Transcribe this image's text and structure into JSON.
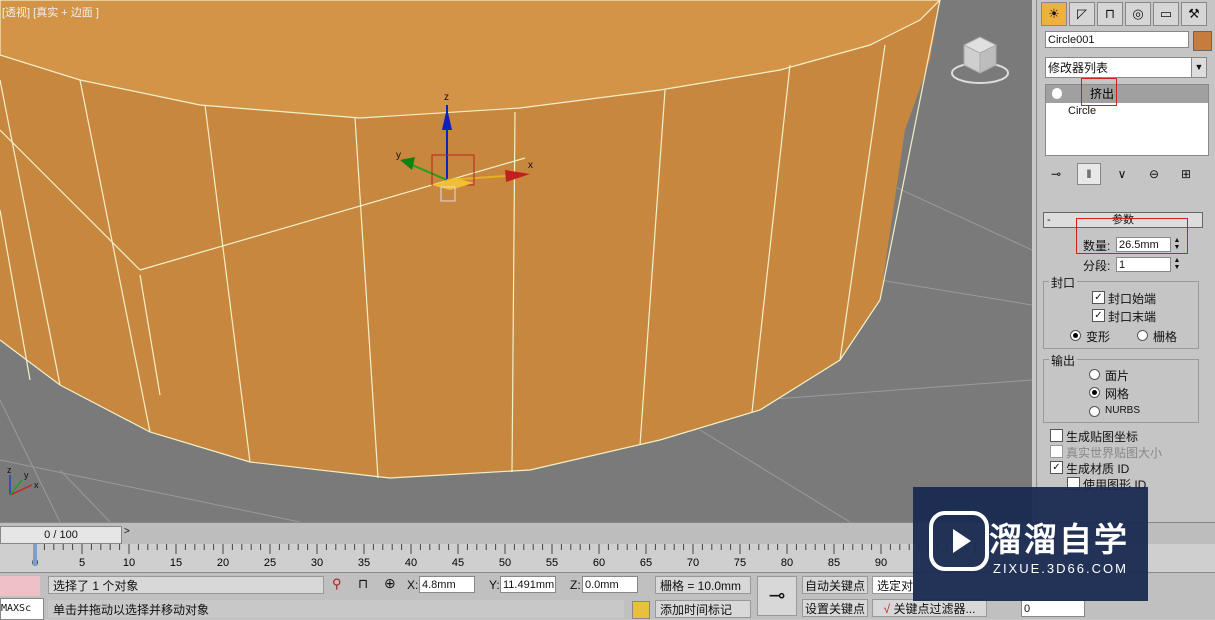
{
  "viewport": {
    "label": "[透视] [真实 + 边面 ]",
    "gizmo_z": "z",
    "gizmo_x": "x",
    "gizmo_y": "y",
    "corner_z": "z",
    "corner_x": "x",
    "corner_y": "y",
    "colors": {
      "ground": "#7a7a7a",
      "object": "#c8873f",
      "object_top": "#d49448",
      "wire": "#f2f0c8"
    }
  },
  "command_panel": {
    "tabs": [
      {
        "icon": "sun-icon",
        "glyph": "☀"
      },
      {
        "icon": "modify-icon",
        "glyph": "◸"
      },
      {
        "icon": "hierarchy-icon",
        "glyph": "⊓"
      },
      {
        "icon": "motion-icon",
        "glyph": "◎"
      },
      {
        "icon": "display-icon",
        "glyph": "▭"
      },
      {
        "icon": "utilities-icon",
        "glyph": "⚒"
      }
    ],
    "object_name": "Circle001",
    "object_color": "#c87c3c",
    "modifier_list": "修改器列表",
    "stack": [
      "挤出",
      "Circle"
    ],
    "params": {
      "title": "参数",
      "amount_label": "数量:",
      "amount_value": "26.5mm",
      "segments_label": "分段:",
      "segments_value": "1"
    },
    "capping": {
      "title": "封口",
      "cap_start": "封口始端",
      "cap_end": "封口末端",
      "morph": "变形",
      "grid": "栅格"
    },
    "output": {
      "title": "输出",
      "patch": "面片",
      "mesh": "网格",
      "nurbs": "NURBS"
    },
    "options": {
      "gen_map_coords": "生成贴图坐标",
      "real_world": "真实世界贴图大小",
      "gen_mat_id": "生成材质 ID",
      "use_shape_id": "使用图形 ID"
    }
  },
  "timeline": {
    "frame": "0 / 100",
    "ticks": [
      "0",
      "5",
      "10",
      "15",
      "20",
      "25",
      "30",
      "35",
      "40",
      "45",
      "50",
      "55",
      "60",
      "65",
      "70",
      "75",
      "80",
      "85",
      "90"
    ]
  },
  "status": {
    "selection": "选择了 1 个对象",
    "prompt": "单击并拖动以选择并移动对象",
    "x_label": "X:",
    "x_value": "4.8mm",
    "y_label": "Y:",
    "y_value": "11.491mm",
    "z_label": "Z:",
    "z_value": "0.0mm",
    "grid": "栅格 = 10.0mm",
    "add_time_tag": "添加时间标记",
    "auto_key": "自动关键点",
    "set_key": "设置关键点",
    "selected": "选定对",
    "key_filters": "关键点过滤器...",
    "frame_field": "0",
    "maxscript": "MAXSc"
  },
  "watermark": {
    "title": "溜溜自学",
    "subtitle": "ZIXUE.3D66.COM"
  }
}
